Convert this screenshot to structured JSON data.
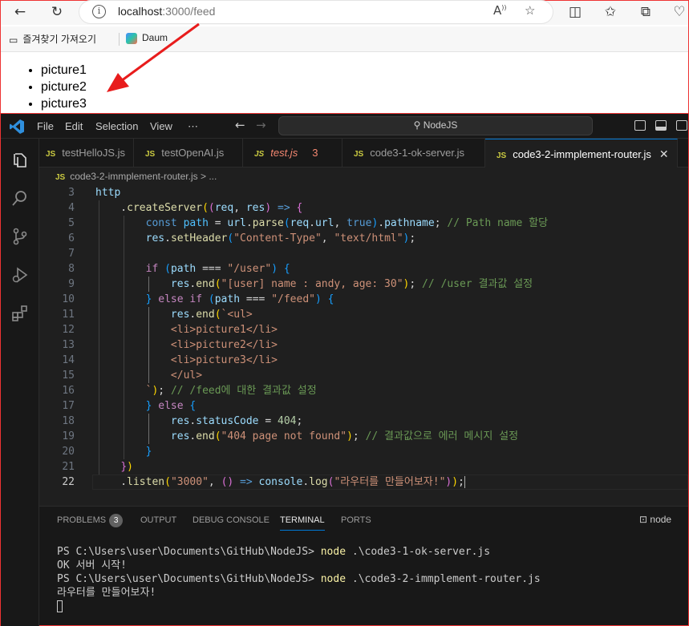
{
  "browser": {
    "url_host": "localhost",
    "url_path": ":3000/feed",
    "favorites": [
      "즐겨찾기 가져오기",
      "Daum"
    ],
    "page_items": [
      "picture1",
      "picture2",
      "picture3"
    ]
  },
  "vscode": {
    "menu": [
      "File",
      "Edit",
      "Selection",
      "View",
      "⋯"
    ],
    "command_center": "NodeJS",
    "tabs": [
      {
        "name": "testHelloJS.js"
      },
      {
        "name": "testOpenAI.js"
      },
      {
        "name": "test.js",
        "problems": "3"
      },
      {
        "name": "code3-1-ok-server.js"
      },
      {
        "name": "code3-2-immplement-router.js"
      }
    ],
    "breadcrumb": {
      "file": "code3-2-immplement-router.js",
      "rest": " > ..."
    },
    "line_numbers": [
      "3",
      "4",
      "5",
      "6",
      "7",
      "8",
      "9",
      "10",
      "11",
      "12",
      "13",
      "14",
      "15",
      "16",
      "17",
      "18",
      "19",
      "20",
      "21",
      "22"
    ],
    "panel_tabs": {
      "problems": "PROBLEMS",
      "problems_count": "3",
      "output": "OUTPUT",
      "debug": "DEBUG CONSOLE",
      "terminal": "TERMINAL",
      "ports": "PORTS"
    },
    "terminal_name": "node",
    "terminal": {
      "prompt": "PS C:\\Users\\user\\Documents\\GitHub\\NodeJS> ",
      "cmd1": "node",
      "arg1": " .\\code3-1-ok-server.js",
      "out1": "OK 서버 시작!",
      "cmd2": "node",
      "arg2": " .\\code3-2-immplement-router.js",
      "out2": "라우터를 만들어보자!"
    }
  },
  "colors": {
    "accent": "#0078d4",
    "arrow": "#e81c1c",
    "keyword": "#569cd6",
    "string": "#ce9178",
    "comment": "#6a9955"
  }
}
